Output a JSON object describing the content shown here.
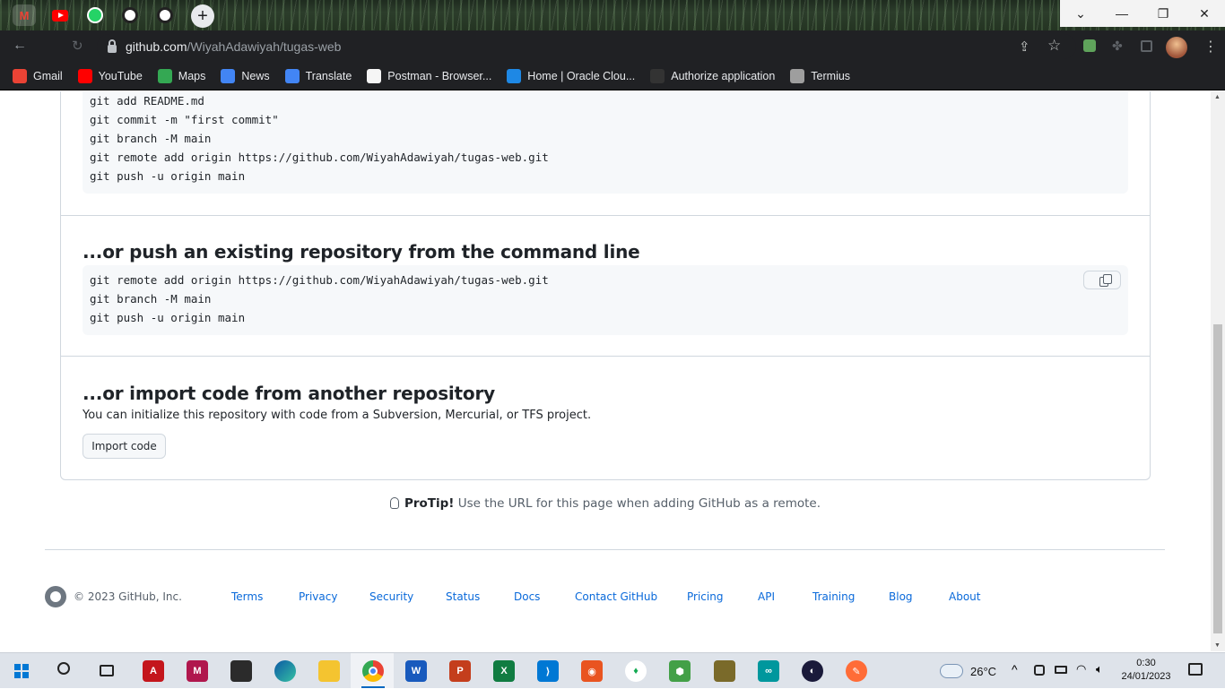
{
  "browser": {
    "url_host": "github.com",
    "url_path": "/WiyahAdawiyah/tugas-web",
    "bookmarks": [
      {
        "label": "Gmail",
        "color": "#ea4335",
        "icon": "gmail-icon"
      },
      {
        "label": "YouTube",
        "color": "#ff0000",
        "icon": "youtube-icon"
      },
      {
        "label": "Maps",
        "color": "#34a853",
        "icon": "maps-icon"
      },
      {
        "label": "News",
        "color": "#4285f4",
        "icon": "news-icon"
      },
      {
        "label": "Translate",
        "color": "#4285f4",
        "icon": "translate-icon"
      },
      {
        "label": "Postman - Browser...",
        "color": "#f5f5f5",
        "icon": "postman-icon"
      },
      {
        "label": "Home | Oracle Clou...",
        "color": "#1e88e5",
        "icon": "cloud-icon"
      },
      {
        "label": "Authorize application",
        "color": "#333333",
        "icon": "github-icon"
      },
      {
        "label": "Termius",
        "color": "#9e9e9e",
        "icon": "termius-icon"
      }
    ]
  },
  "page": {
    "new_repo_code": [
      "git add README.md",
      "git commit -m \"first commit\"",
      "git branch -M main",
      "git remote add origin https://github.com/WiyahAdawiyah/tugas-web.git",
      "git push -u origin main"
    ],
    "push_heading": "...or push an existing repository from the command line",
    "push_code": [
      "git remote add origin https://github.com/WiyahAdawiyah/tugas-web.git",
      "git branch -M main",
      "git push -u origin main"
    ],
    "import_heading": "...or import code from another repository",
    "import_desc": "You can initialize this repository with code from a Subversion, Mercurial, or TFS project.",
    "import_button": "Import code",
    "protip_label": "ProTip!",
    "protip_text": " Use the URL for this page when adding GitHub as a remote."
  },
  "footer": {
    "copyright": "© 2023 GitHub, Inc.",
    "links": [
      "Terms",
      "Privacy",
      "Security",
      "Status",
      "Docs",
      "Contact GitHub",
      "Pricing",
      "API",
      "Training",
      "Blog",
      "About"
    ]
  },
  "taskbar": {
    "weather_temp": "26°C",
    "time": "0:30",
    "date": "24/01/2023"
  },
  "colors": {
    "link": "#0969da",
    "border": "#d0d7de",
    "code_bg": "#f6f8fa"
  }
}
